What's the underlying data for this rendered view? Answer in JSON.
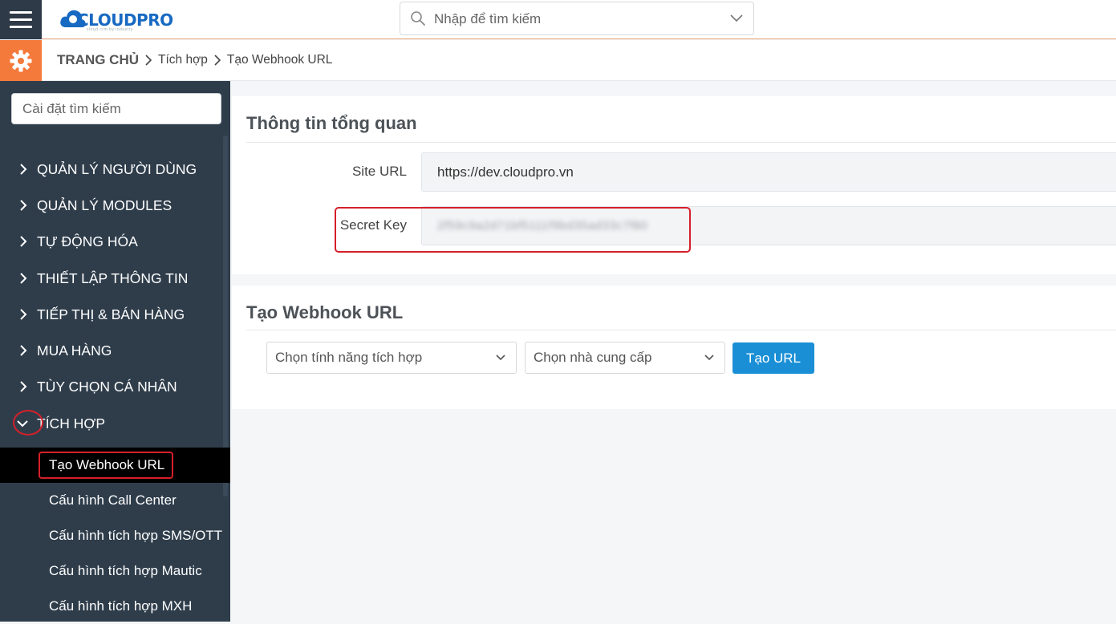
{
  "topbar": {
    "logo_text": "CLOUDPRO",
    "logo_tagline": "cloud crm by industry",
    "search_placeholder": "Nhập để tìm kiếm"
  },
  "breadcrumb": {
    "home": "TRANG CHỦ",
    "level1": "Tích hợp",
    "level2": "Tạo Webhook URL"
  },
  "sidebar": {
    "search_placeholder": "Cài đặt tìm kiếm",
    "items": [
      {
        "label": "QUẢN LÝ NGƯỜI DÙNG"
      },
      {
        "label": "QUẢN LÝ MODULES"
      },
      {
        "label": "TỰ ĐỘNG HÓA"
      },
      {
        "label": "THIẾT LẬP THÔNG TIN"
      },
      {
        "label": "TIẾP THỊ & BÁN HÀNG"
      },
      {
        "label": "MUA HÀNG"
      },
      {
        "label": "TÙY CHỌN CÁ NHÂN"
      },
      {
        "label": "TÍCH HỢP"
      }
    ],
    "subitems": [
      {
        "label": "Tạo Webhook URL"
      },
      {
        "label": "Cấu hình Call Center"
      },
      {
        "label": "Cấu hình tích hợp SMS/OTT"
      },
      {
        "label": "Cấu hình tích hợp Mautic"
      },
      {
        "label": "Cấu hình tích hợp MXH"
      }
    ]
  },
  "overview": {
    "title": "Thông tin tổng quan",
    "site_url_label": "Site URL",
    "site_url_value": "https://dev.cloudpro.vn",
    "secret_key_label": "Secret Key",
    "secret_key_value": "2f59c9a2d71bf5111f9bd35ad33c7f80"
  },
  "webhook": {
    "title": "Tạo Webhook URL",
    "feature_select": "Chọn tính năng tích hợp",
    "provider_select": "Chọn nhà cung cấp",
    "create_button": "Tạo URL"
  },
  "colors": {
    "sidebar_bg": "#2f3d4b",
    "accent_orange": "#f47a3b",
    "brand_blue": "#1769c2",
    "button_blue": "#1a8fd6",
    "highlight_red": "#d5202a"
  }
}
